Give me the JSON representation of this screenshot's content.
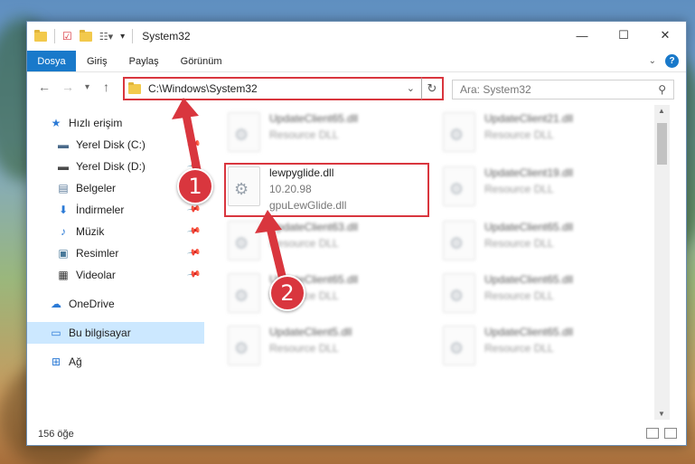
{
  "window": {
    "title": "System32",
    "controls": {
      "minimize": "—",
      "maximize": "☐",
      "close": "✕"
    }
  },
  "ribbon": {
    "tabs": [
      "Dosya",
      "Giriş",
      "Paylaş",
      "Görünüm"
    ],
    "help": "?"
  },
  "address": {
    "path": "C:\\Windows\\System32",
    "search_placeholder": "Ara: System32"
  },
  "sidebar": {
    "quick_access": "Hızlı erişim",
    "items": [
      {
        "label": "Yerel Disk (C:)",
        "icon": "drive-icon",
        "pinned": true
      },
      {
        "label": "Yerel Disk (D:)",
        "icon": "drive-icon",
        "pinned": true
      },
      {
        "label": "Belgeler",
        "icon": "documents-icon",
        "pinned": true
      },
      {
        "label": "İndirmeler",
        "icon": "download-icon",
        "pinned": true
      },
      {
        "label": "Müzik",
        "icon": "music-icon",
        "pinned": true
      },
      {
        "label": "Resimler",
        "icon": "pictures-icon",
        "pinned": true
      },
      {
        "label": "Videolar",
        "icon": "video-icon",
        "pinned": true
      }
    ],
    "onedrive": "OneDrive",
    "this_pc": "Bu bilgisayar",
    "network": "Ağ"
  },
  "files": {
    "highlighted": {
      "name": "lewpyglide.dll",
      "version": "10.20.98",
      "description": "gpuLewGlide.dll"
    },
    "left_column": [
      {
        "name": "UpdateClient65.dll",
        "type": "Resource DLL"
      },
      {
        "name": "UpdateClient63.dll",
        "type": "Resource DLL"
      },
      {
        "name": "UpdateClient65.dll",
        "type": "Resource DLL"
      },
      {
        "name": "UpdateClient5.dll",
        "type": "Resource DLL"
      }
    ],
    "right_column": [
      {
        "name": "UpdateClient21.dll",
        "type": "Resource DLL"
      },
      {
        "name": "UpdateClient19.dll",
        "type": "Resource DLL"
      },
      {
        "name": "UpdateClient65.dll",
        "type": "Resource DLL"
      },
      {
        "name": "UpdateClient65.dll",
        "type": "Resource DLL"
      },
      {
        "name": "UpdateClient65.dll",
        "type": "Resource DLL"
      }
    ]
  },
  "status": {
    "count": "156 öğe"
  },
  "annotations": {
    "step1": "1",
    "step2": "2",
    "color": "#d9363e"
  }
}
